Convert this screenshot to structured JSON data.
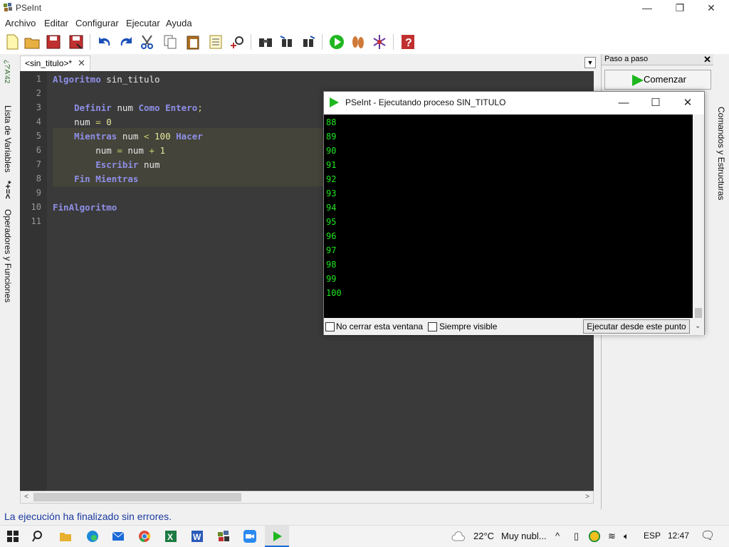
{
  "window": {
    "title": "PSeInt",
    "minimize": "—",
    "maximize": "❐",
    "close": "✕"
  },
  "menu": [
    "Archivo",
    "Editar",
    "Configurar",
    "Ejecutar",
    "Ayuda"
  ],
  "left_panel": {
    "variables_label": "Lista de Variables",
    "operators_label": "Operadores y Funciones",
    "variables_glyph": "¿?'A'42",
    "operators_glyph": "*+=<"
  },
  "editor": {
    "tab_label": "<sin_titulo>*",
    "tab_close": "✕",
    "line_numbers": [
      "1",
      "2",
      "3",
      "4",
      "5",
      "6",
      "7",
      "8",
      "9",
      "10",
      "11"
    ],
    "lines": [
      {
        "n": 1,
        "parts": [
          [
            "kw",
            "Algoritmo"
          ],
          [
            "txt",
            " sin_titulo"
          ]
        ]
      },
      {
        "n": 2,
        "parts": []
      },
      {
        "n": 3,
        "parts": [
          [
            "txt",
            "    "
          ],
          [
            "kw",
            "Definir"
          ],
          [
            "txt",
            " num "
          ],
          [
            "kw",
            "Como Entero"
          ],
          [
            "op",
            ";"
          ]
        ]
      },
      {
        "n": 4,
        "parts": [
          [
            "txt",
            "    num "
          ],
          [
            "op",
            "="
          ],
          [
            "txt",
            " "
          ],
          [
            "num",
            "0"
          ]
        ]
      },
      {
        "n": 5,
        "parts": [
          [
            "txt",
            "    "
          ],
          [
            "kw",
            "Mientras"
          ],
          [
            "txt",
            " num "
          ],
          [
            "op",
            "<"
          ],
          [
            "txt",
            " "
          ],
          [
            "num",
            "100"
          ],
          [
            "txt",
            " "
          ],
          [
            "kw",
            "Hacer"
          ]
        ]
      },
      {
        "n": 6,
        "parts": [
          [
            "txt",
            "        num "
          ],
          [
            "op",
            "="
          ],
          [
            "txt",
            " num "
          ],
          [
            "op",
            "+"
          ],
          [
            "txt",
            " "
          ],
          [
            "num",
            "1"
          ]
        ]
      },
      {
        "n": 7,
        "parts": [
          [
            "txt",
            "        "
          ],
          [
            "kw",
            "Escribir"
          ],
          [
            "txt",
            " num"
          ]
        ]
      },
      {
        "n": 8,
        "parts": [
          [
            "txt",
            "    "
          ],
          [
            "kw",
            "Fin Mientras"
          ]
        ]
      },
      {
        "n": 9,
        "parts": []
      },
      {
        "n": 10,
        "parts": [
          [
            "kw",
            "FinAlgoritmo"
          ]
        ]
      },
      {
        "n": 11,
        "parts": []
      }
    ]
  },
  "right_panel": {
    "header": "Paso a paso",
    "close": "✕",
    "start_button": "Comenzar",
    "commands_label": "Comandos y Estructuras"
  },
  "status": "La ejecución ha finalizado sin errores.",
  "console": {
    "title": "PSeInt - Ejecutando proceso SIN_TITULO",
    "minimize": "—",
    "maximize": "☐",
    "close": "✕",
    "output": [
      "88",
      "89",
      "90",
      "91",
      "92",
      "93",
      "94",
      "95",
      "96",
      "97",
      "98",
      "99",
      "100"
    ],
    "no_close_label": "No cerrar esta ventana",
    "always_visible_label": "Siempre visible",
    "run_from_here_button": "Ejecutar desde este punto"
  },
  "taskbar": {
    "temperature": "22°C",
    "weather": "Muy nubl...",
    "language": "ESP",
    "time": "12:47"
  },
  "colors": {
    "editor_bg": "#3a3a3a",
    "keyword": "#8f8fe8",
    "console_text": "#1ee61e",
    "status_text": "#1a3aa0",
    "run_green": "#1fb71f"
  }
}
